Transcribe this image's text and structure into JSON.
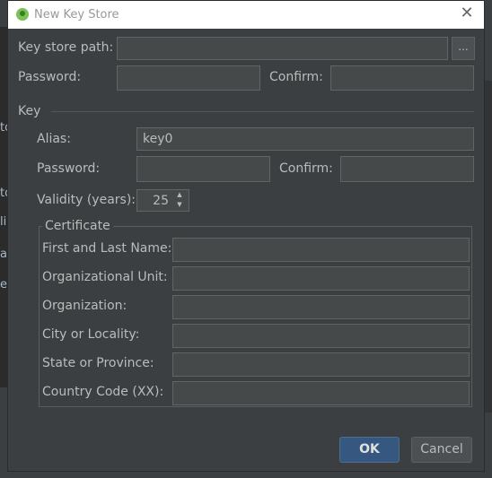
{
  "window": {
    "title": "New Key Store"
  },
  "keystore": {
    "path_label": "Key store path:",
    "path_value": "",
    "browse_label": "...",
    "password_label": "Password:",
    "confirm_label": "Confirm:"
  },
  "key": {
    "section_label": "Key",
    "alias_label": "Alias:",
    "alias_value": "key0",
    "password_label": "Password:",
    "confirm_label": "Confirm:",
    "validity_label": "Validity (years):",
    "validity_value": "25"
  },
  "certificate": {
    "section_label": "Certificate",
    "fields": [
      {
        "label": "First and Last Name:",
        "value": ""
      },
      {
        "label": "Organizational Unit:",
        "value": ""
      },
      {
        "label": "Organization:",
        "value": ""
      },
      {
        "label": "City or Locality:",
        "value": ""
      },
      {
        "label": "State or Province:",
        "value": ""
      },
      {
        "label": "Country Code (XX):",
        "value": ""
      }
    ]
  },
  "buttons": {
    "ok": "OK",
    "cancel": "Cancel"
  },
  "colors": {
    "accent": "#365880",
    "background": "#3c3f41",
    "field": "#45494a"
  }
}
